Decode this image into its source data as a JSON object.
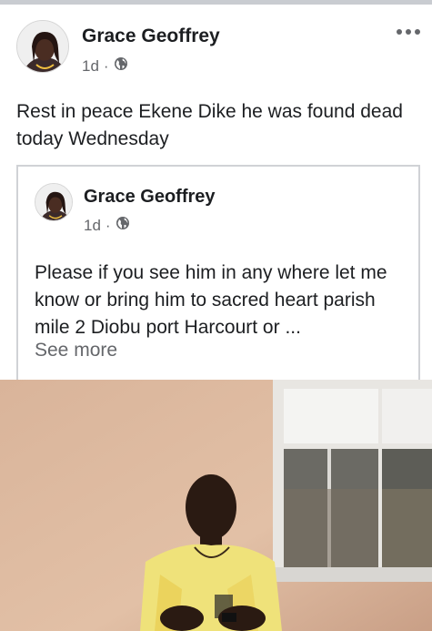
{
  "post": {
    "author": "Grace Geoffrey",
    "time": "1d",
    "separator": "·",
    "text": "Rest in peace Ekene Dike he was found dead today Wednesday"
  },
  "shared_post": {
    "author": "Grace Geoffrey",
    "time": "1d",
    "separator": "·",
    "text": "Please if you see him in any where let me know or bring him to sacred heart parish mile 2 Diobu port Harcourt or ...",
    "see_more": "See more"
  },
  "icons": {
    "privacy": "globe-icon",
    "menu": "more-options-icon"
  },
  "colors": {
    "text": "#1c1e21",
    "secondary": "#65676b",
    "card_border": "#d0d2d6"
  }
}
